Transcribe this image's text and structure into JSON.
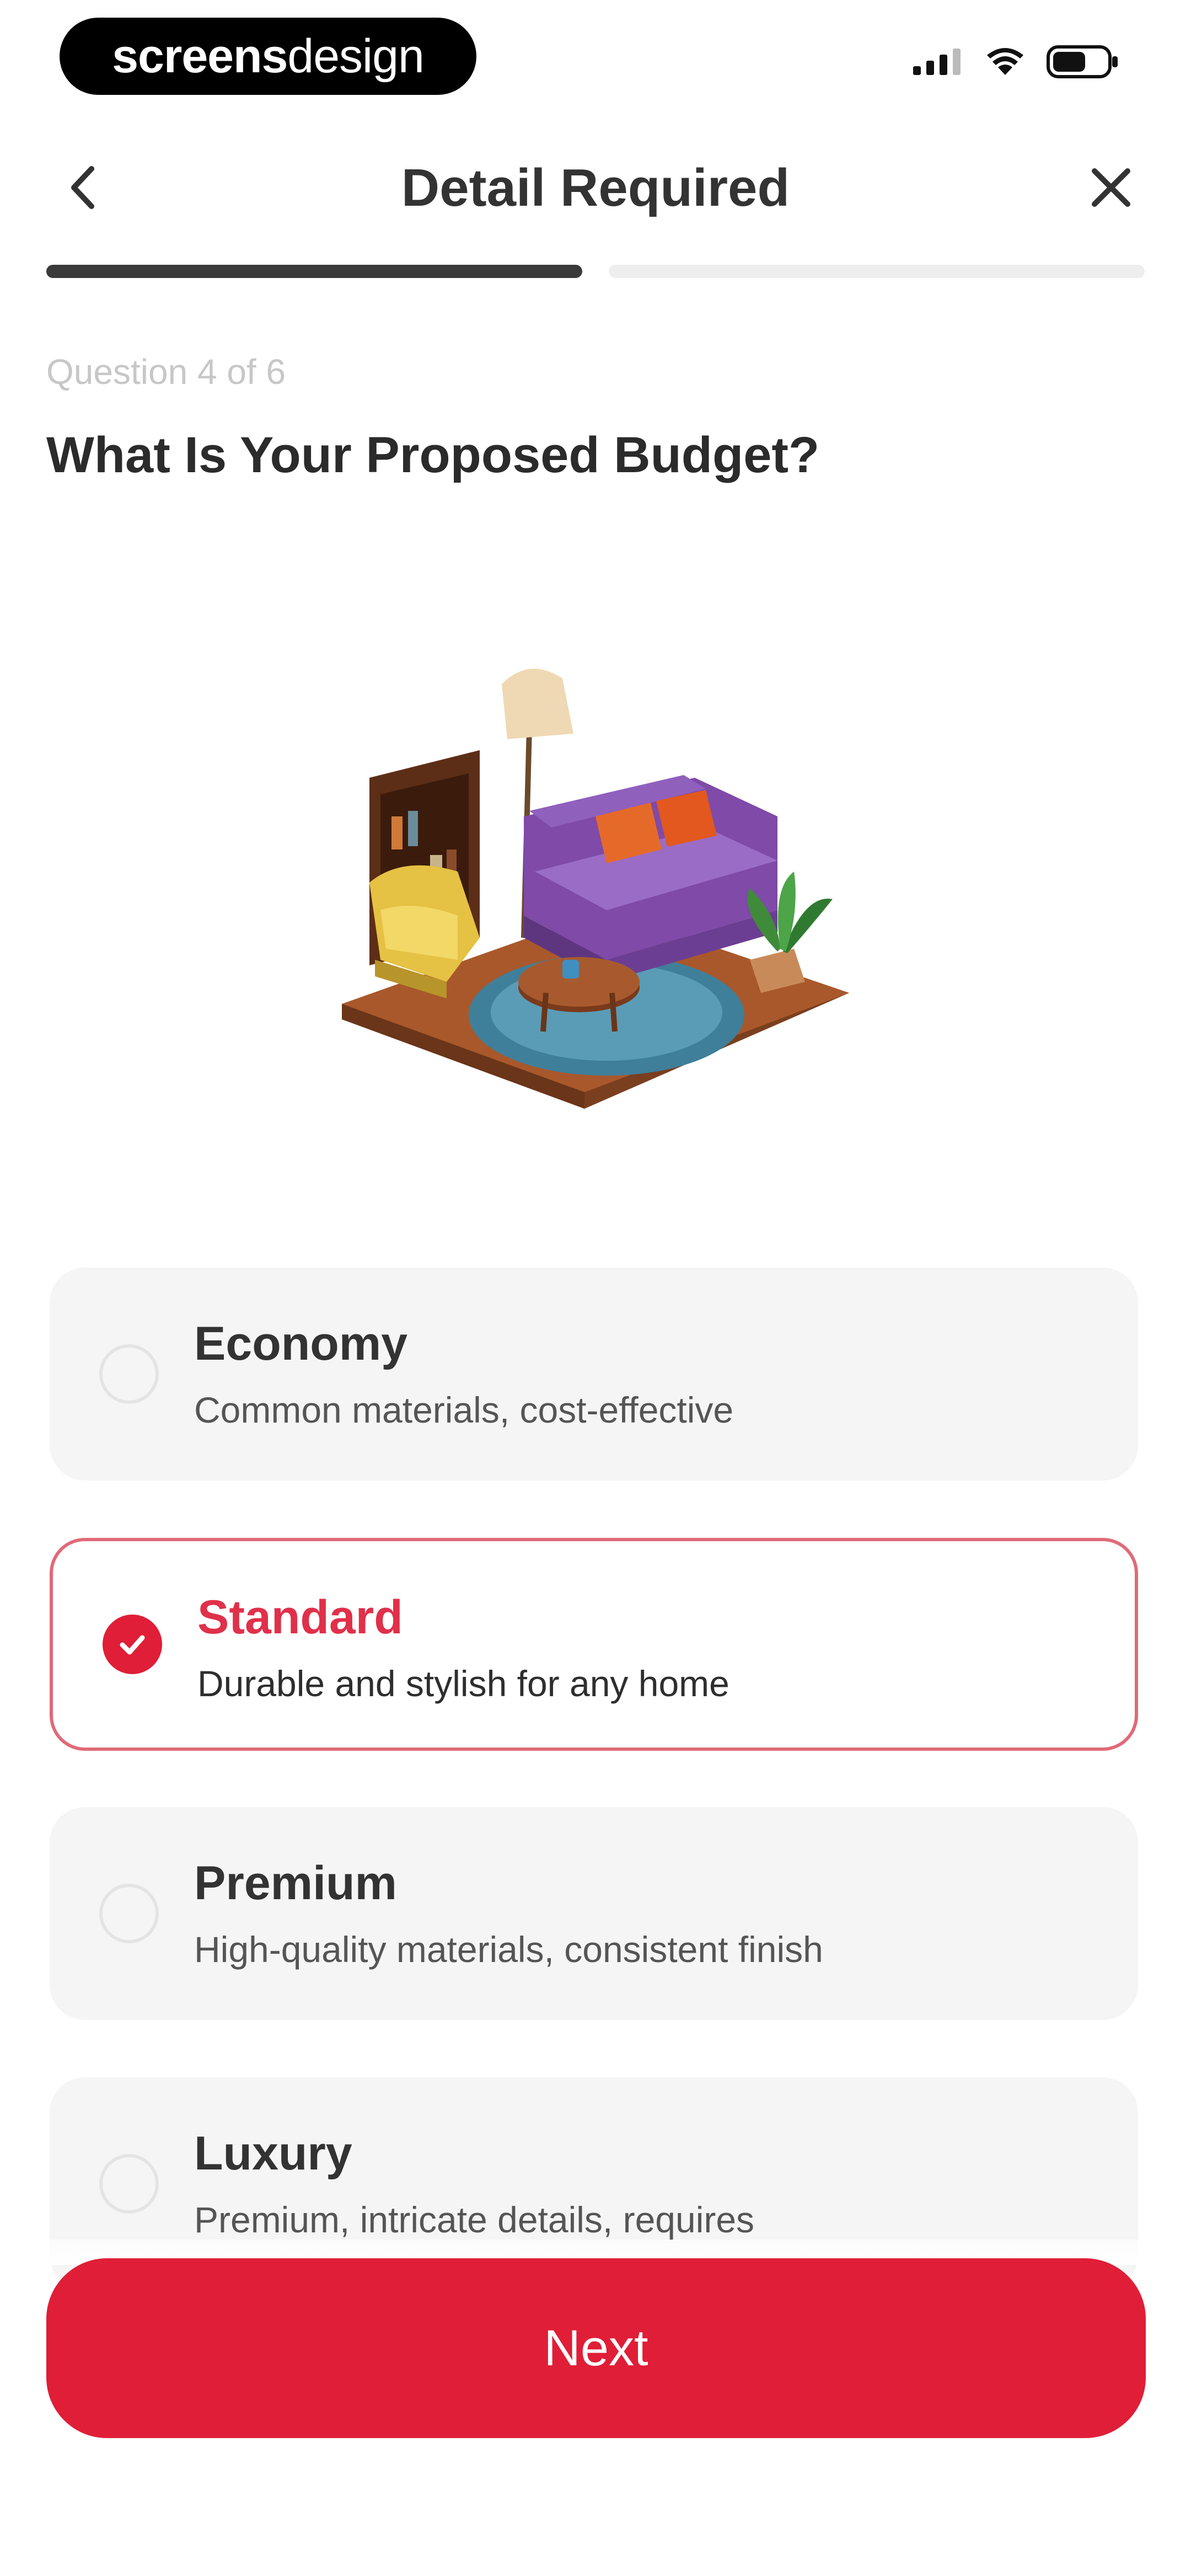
{
  "status_bar": {
    "brand_bold": "screens",
    "brand_light": "design",
    "icons": [
      "signal-icon",
      "wifi-icon",
      "battery-icon"
    ]
  },
  "header": {
    "title": "Detail Required",
    "back_icon": "chevron-left-icon",
    "close_icon": "close-icon"
  },
  "progress": {
    "total_steps": 2,
    "completed_steps": 1
  },
  "question": {
    "counter": "Question 4 of 6",
    "title": "What Is Your Proposed Budget?"
  },
  "illustration": {
    "name": "living-room-illustration"
  },
  "options": [
    {
      "title": "Economy",
      "desc": "Common materials, cost-effective",
      "selected": false
    },
    {
      "title": "Standard",
      "desc": "Durable and stylish for any home",
      "selected": true
    },
    {
      "title": "Premium",
      "desc": "High-quality materials, consistent finish",
      "selected": false
    },
    {
      "title": "Luxury",
      "desc": "Premium, intricate details, requires",
      "selected": false
    }
  ],
  "next_button": {
    "label": "Next"
  },
  "colors": {
    "accent": "#e01e37",
    "selected_border": "#e06a78",
    "card_bg": "#f5f5f5",
    "progress_done": "#3a3a3a",
    "progress_todo": "#eeeeee"
  }
}
